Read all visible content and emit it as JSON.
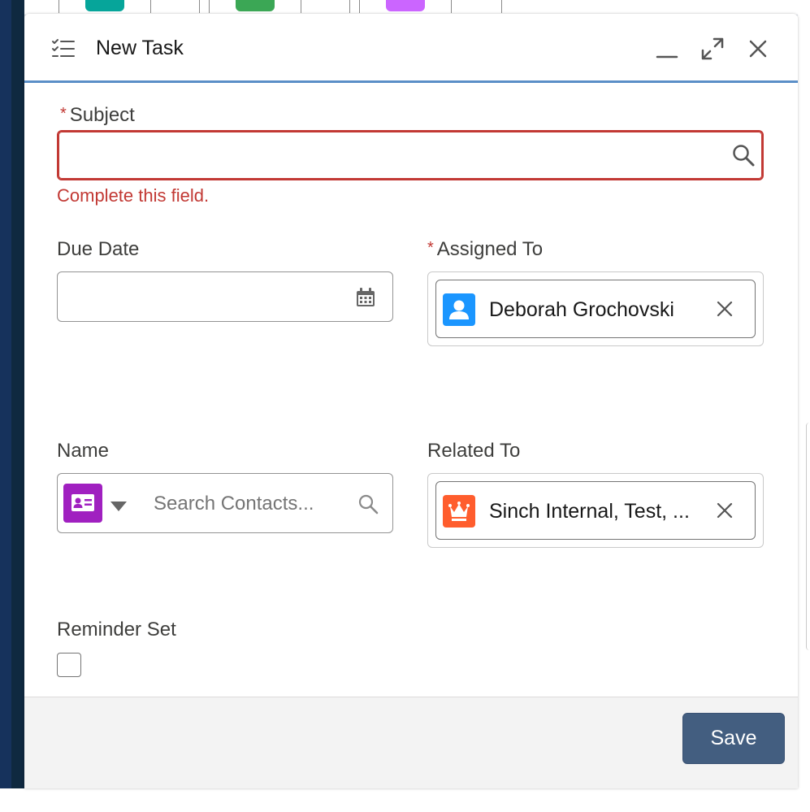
{
  "modal": {
    "title": "New Task",
    "header_icon": "task-list-icon",
    "controls": [
      "minimize-icon",
      "expand-icon",
      "close-icon"
    ]
  },
  "subject": {
    "label": "Subject",
    "required_mark": "*",
    "value": "",
    "error": "Complete this field."
  },
  "due_date": {
    "label": "Due Date",
    "value": ""
  },
  "assigned_to": {
    "label": "Assigned To",
    "required_mark": "*",
    "value": "Deborah Grochovski",
    "icon": "user-icon",
    "icon_color": "#1b96ff"
  },
  "name": {
    "label": "Name",
    "object_icon": "contact-card-icon",
    "object_icon_color": "#a020c0",
    "placeholder": "Search Contacts..."
  },
  "related_to": {
    "label": "Related To",
    "value": "Sinch Internal, Test, ...",
    "icon": "crown-icon",
    "icon_color": "#ff5d2d"
  },
  "reminder": {
    "label": "Reminder Set",
    "checked": false
  },
  "footer": {
    "save_label": "Save",
    "save_color": "#435e80"
  },
  "colors": {
    "error": "#c23934",
    "header_border": "#5b8fc7"
  }
}
